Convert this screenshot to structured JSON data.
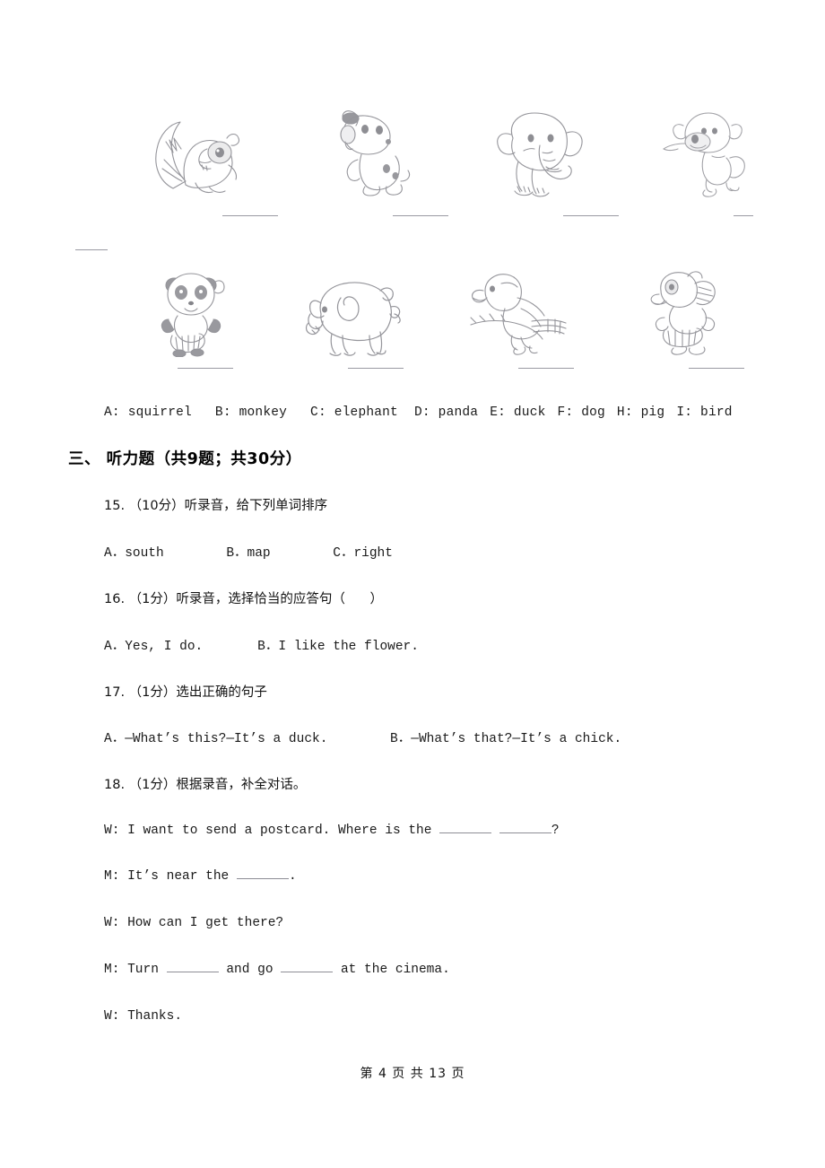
{
  "page": {
    "footer": "第 4 页 共 13 页"
  },
  "picture_exercise": {
    "row1": [
      {
        "animal": "squirrel",
        "icon": "squirrel-drawing"
      },
      {
        "animal": "dog",
        "icon": "dog-drawing"
      },
      {
        "animal": "elephant",
        "icon": "elephant-drawing"
      },
      {
        "animal": "monkey",
        "icon": "monkey-drawing"
      }
    ],
    "row2": [
      {
        "animal": "panda",
        "icon": "panda-drawing"
      },
      {
        "animal": "pig",
        "icon": "pig-drawing"
      },
      {
        "animal": "bird",
        "icon": "bird-drawing"
      },
      {
        "animal": "duck",
        "icon": "duck-drawing"
      }
    ],
    "answer_key": {
      "a": "A: squirrel",
      "b": "B: monkey",
      "c": "C: elephant",
      "d": "D: panda",
      "e": "E: duck",
      "f": "F: dog",
      "h": "H: pig",
      "i": "I: bird"
    }
  },
  "section": {
    "heading": "三、 听力题（共9题；共30分）"
  },
  "questions": [
    {
      "number": "15.",
      "points": "（10分）",
      "stem": "15. （10分）听录音，给下列单词排序",
      "options": "A．south        B．map        C．right"
    },
    {
      "number": "16.",
      "points": "（1分）",
      "stem": "16. （1分）听录音，选择恰当的应答句（      ）",
      "options": "A．Yes, I do.       B．I like the flower."
    },
    {
      "number": "17.",
      "points": "（1分）",
      "stem": "17. （1分）选出正确的句子",
      "options": "A．—What’s this?—It’s a duck.        B．—What’s that?—It’s a chick."
    },
    {
      "number": "18.",
      "points": "（1分）",
      "stem": "18. （1分）根据录音，补全对话。",
      "options": ""
    }
  ],
  "dialogue": {
    "line1_a": "W: I want to send a postcard. Where is the ",
    "line1_b": " ",
    "line1_c": "?",
    "line2_a": "M: It’s near the ",
    "line2_b": ".",
    "line3": "W: How can I get there?",
    "line4_a": "M: Turn ",
    "line4_b": " and go ",
    "line4_c": " at the cinema.",
    "line5": "W: Thanks."
  }
}
